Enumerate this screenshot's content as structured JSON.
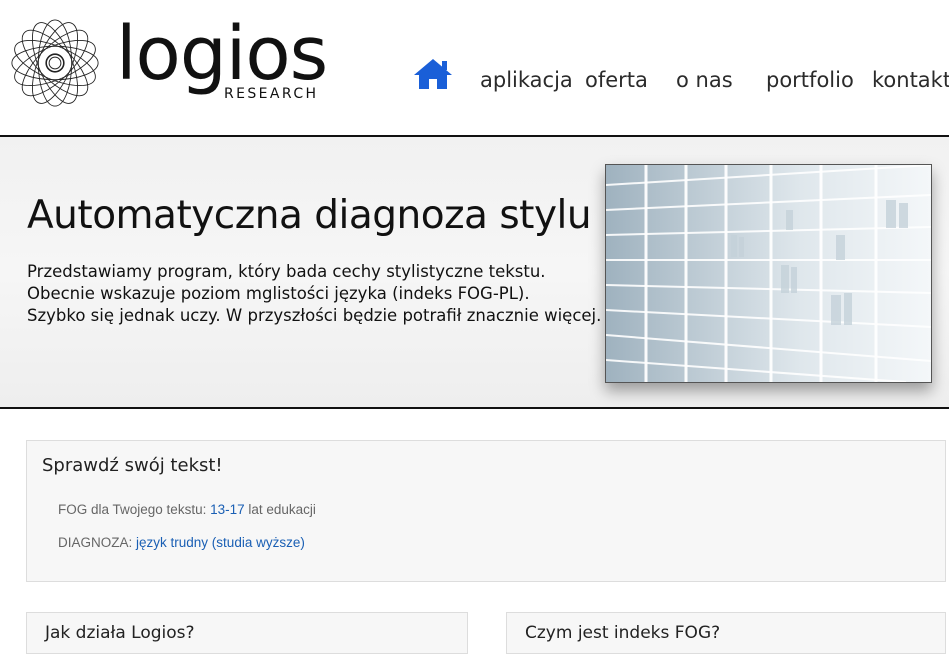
{
  "header": {
    "logo": {
      "word": "logios",
      "subtitle": "RESEARCH",
      "icon": "rosette-logo-icon"
    },
    "nav": {
      "home_icon": "home-icon",
      "home_color": "#1a5fd8",
      "items": [
        {
          "label": "aplikacja"
        },
        {
          "label": "oferta"
        },
        {
          "label": "o nas"
        },
        {
          "label": "portfolio"
        },
        {
          "label": "kontakt"
        }
      ]
    }
  },
  "hero": {
    "title": "Automatyczna diagnoza stylu",
    "lines": [
      "Przedstawiamy program, który bada cechy stylistyczne tekstu.",
      "Obecnie wskazuje poziom mglistości języka (indeks FOG-PL).",
      "Szybko się jednak uczy. W przyszłości będzie potrafił znacznie więcej."
    ],
    "image": "bookshelf-image"
  },
  "check": {
    "title": "Sprawdź swój tekst!",
    "fog_prefix": "FOG dla Twojego tekstu:",
    "fog_value": "13-17",
    "fog_suffix": "lat edukacji",
    "diag_prefix": "DIAGNOZA:",
    "diag_value": "język trudny (studia wyższe)"
  },
  "lower": {
    "left_title": "Jak działa Logios?",
    "right_title": "Czym jest indeks FOG?"
  },
  "colors": {
    "link": "#1a5fb4",
    "rule": "#111111"
  }
}
